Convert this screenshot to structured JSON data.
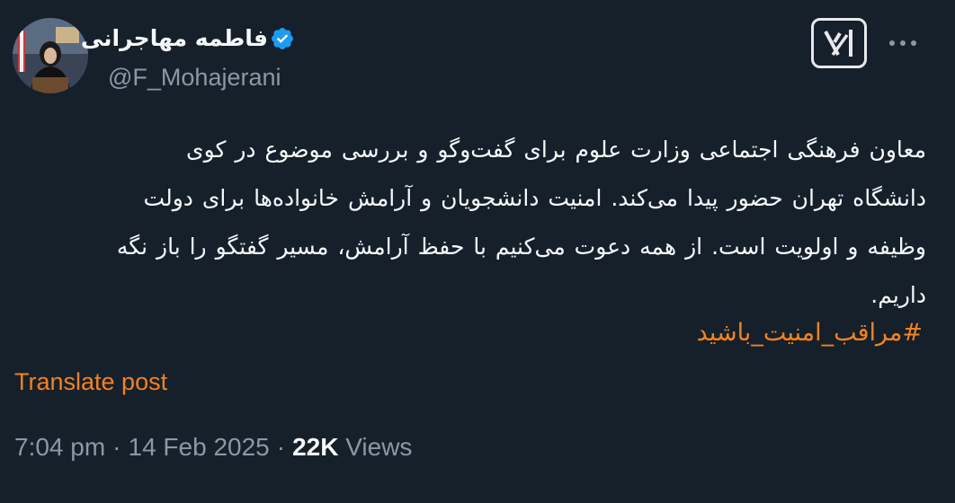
{
  "author": {
    "display_name": "فاطمه مهاجرانی",
    "handle": "@F_Mohajerani",
    "verified": true
  },
  "header": {
    "grok_icon": "grok-icon",
    "more_icon": "more-icon"
  },
  "post": {
    "lines": [
      "معاون فرهنگی اجتماعی وزارت علوم برای گفت‌وگو و بررسی موضوع در کوی",
      "دانشگاه تهران حضور پیدا می‌کند. امنیت دانشجویان و آرامش خانواده‌ها برای دولت",
      "وظیفه و اولویت است. از همه دعوت می‌کنیم با حفظ آرامش، مسیر گفتگو را باز نگه",
      "داریم."
    ],
    "hashtag": "#مراقب_امنیت_باشید"
  },
  "translate_label": "Translate post",
  "meta": {
    "time": "7:04 pm",
    "separator": "·",
    "date": "14 Feb 2025",
    "views_count": "22K",
    "views_label": "Views"
  },
  "colors": {
    "background": "#15202b",
    "accent": "#f4821f",
    "secondary_text": "#8b98a5",
    "verified_badge": "#1d9bf0"
  }
}
